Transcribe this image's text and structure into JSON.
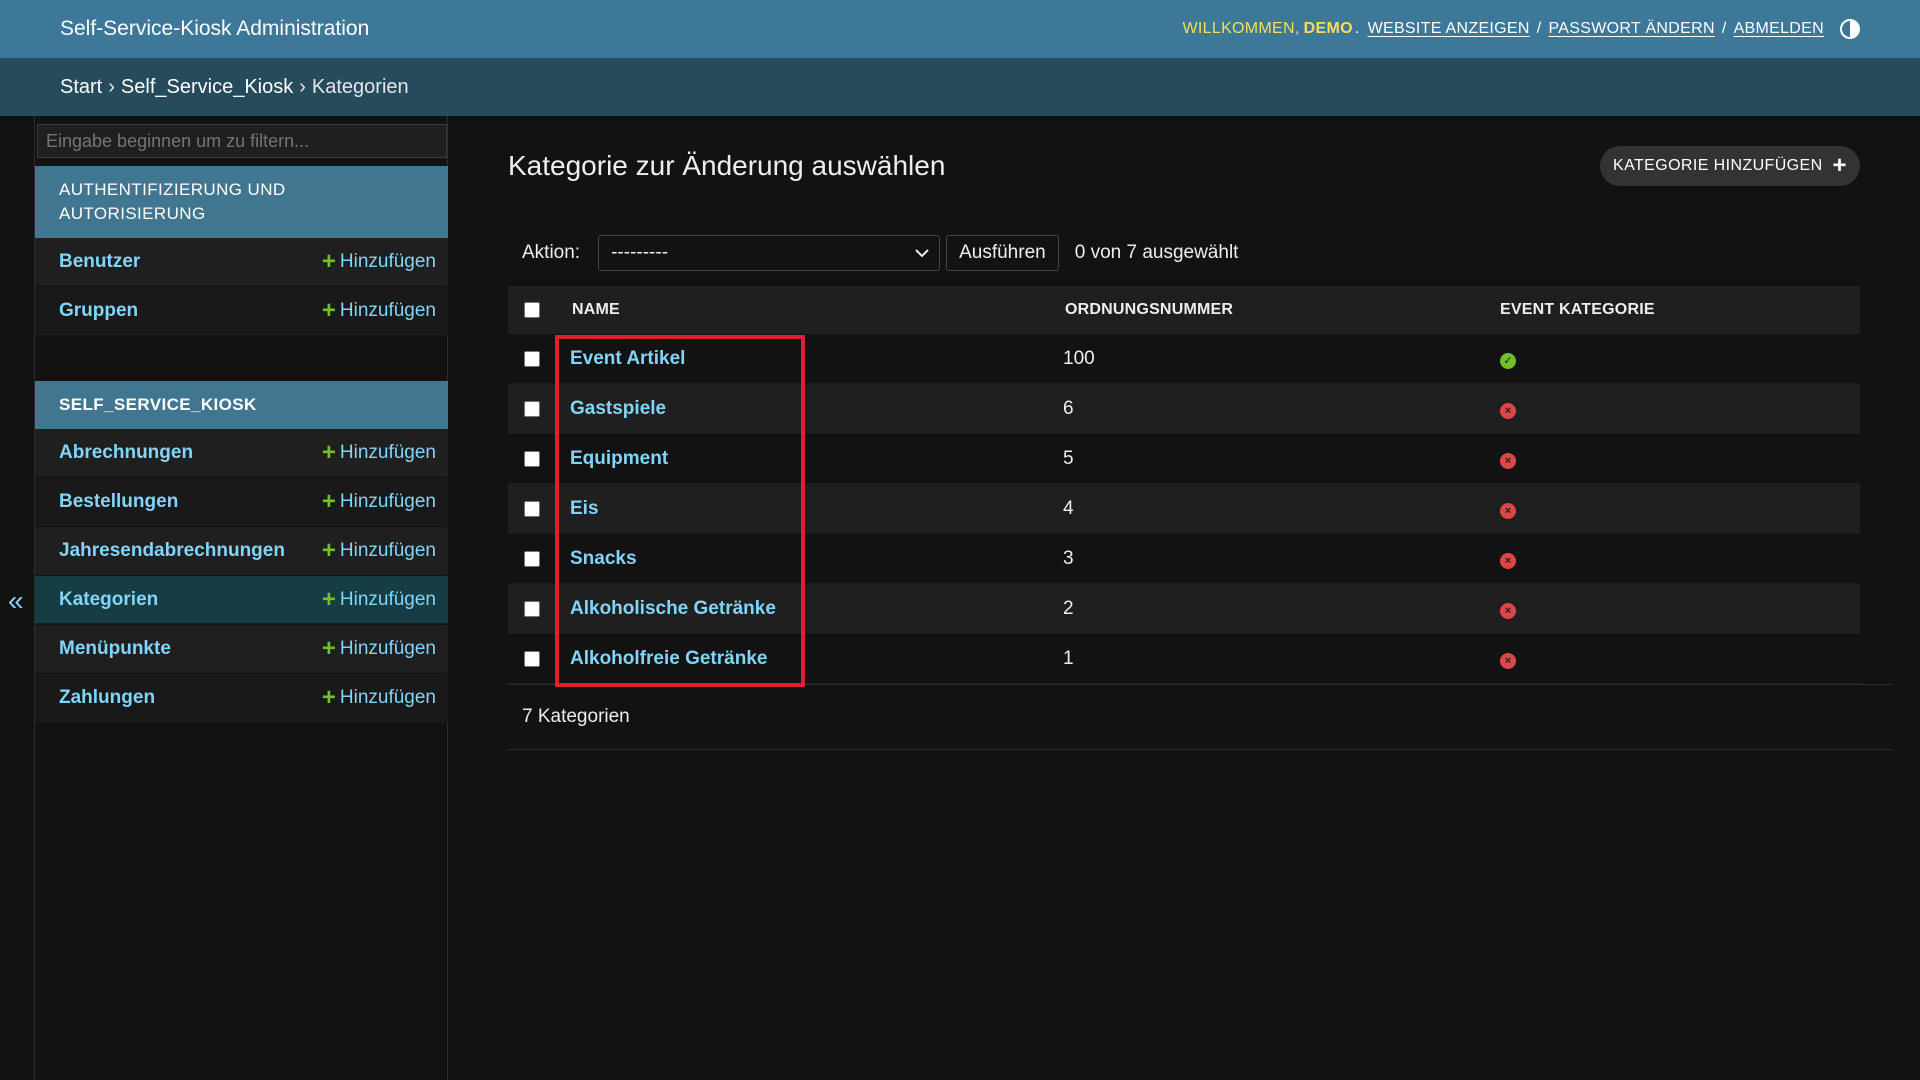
{
  "header": {
    "site_title": "Self-Service-Kiosk Administration",
    "welcome": "Willkommen,",
    "username": "DEMO",
    "dot": ".",
    "links": [
      "Website anzeigen",
      "Passwort ändern",
      "Abmelden"
    ],
    "separator": "/"
  },
  "breadcrumbs": {
    "items": [
      "Start",
      "Self_Service_Kiosk",
      "Kategorien"
    ],
    "separator": "›"
  },
  "sidebar": {
    "filter_placeholder": "Eingabe beginnen um zu filtern...",
    "toggle": "«",
    "add_label": "Hinzufügen",
    "modules": [
      {
        "caption": "AUTHENTIFIZIERUNG UND AUTORISIERUNG",
        "models": [
          "Benutzer",
          "Gruppen"
        ]
      },
      {
        "caption": "SELF_SERVICE_KIOSK",
        "models": [
          "Abrechnungen",
          "Bestellungen",
          "Jahresendabrechnungen",
          "Kategorien",
          "Menüpunkte",
          "Zahlungen"
        ]
      }
    ],
    "current": "Kategorien"
  },
  "content": {
    "title": "Kategorie zur Änderung auswählen",
    "add_button": "KATEGORIE HINZUFÜGEN",
    "action_label": "Aktion:",
    "action_value": "---------",
    "run_button": "Ausführen",
    "selection_count": "0 von 7 ausgewählt",
    "columns": [
      "NAME",
      "ORDNUNGSNUMMER",
      "EVENT KATEGORIE"
    ],
    "rows": [
      {
        "name": "Event Artikel",
        "order": "100",
        "event": true
      },
      {
        "name": "Gastspiele",
        "order": "6",
        "event": false
      },
      {
        "name": "Equipment",
        "order": "5",
        "event": false
      },
      {
        "name": "Eis",
        "order": "4",
        "event": false
      },
      {
        "name": "Snacks",
        "order": "3",
        "event": false
      },
      {
        "name": "Alkoholische Getränke",
        "order": "2",
        "event": false
      },
      {
        "name": "Alkoholfreie Getränke",
        "order": "1",
        "event": false
      }
    ],
    "paginator": "7 Kategorien"
  },
  "colors": {
    "header_bg": "#3e7898",
    "breadcrumb_bg": "#264b5d",
    "link": "#81d4fa",
    "accent_yellow": "#f5dd5d",
    "add_green": "#70bf2b",
    "no_red": "#dd4646",
    "highlight": "#e0202e"
  },
  "icons": {
    "yes": "check-circle-icon",
    "no": "x-circle-icon",
    "plus": "plus-icon",
    "theme": "theme-toggle-icon",
    "select": "chevron-down-icon"
  }
}
